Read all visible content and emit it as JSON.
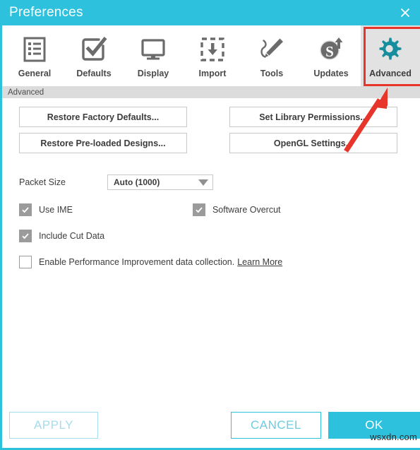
{
  "window": {
    "title": "Preferences",
    "close_icon": "close-x-icon",
    "accent_color": "#2ec1dd",
    "highlight_color": "#e8352b"
  },
  "tabs": [
    {
      "label": "General",
      "icon": "list-document-icon",
      "selected": false
    },
    {
      "label": "Defaults",
      "icon": "checkbox-check-icon",
      "selected": false
    },
    {
      "label": "Display",
      "icon": "monitor-icon",
      "selected": false
    },
    {
      "label": "Import",
      "icon": "import-download-icon",
      "selected": false
    },
    {
      "label": "Tools",
      "icon": "pen-tool-icon",
      "selected": false
    },
    {
      "label": "Updates",
      "icon": "updates-s-arrow-icon",
      "selected": false
    },
    {
      "label": "Advanced",
      "icon": "gear-icon",
      "selected": true
    }
  ],
  "subheader": {
    "label": "Advanced"
  },
  "content": {
    "buttons_left": [
      {
        "label": "Restore Factory Defaults..."
      },
      {
        "label": "Restore Pre-loaded Designs..."
      }
    ],
    "buttons_right": [
      {
        "label": "Set Library Permissions..."
      },
      {
        "label": "OpenGL Settings..."
      }
    ],
    "packet_size": {
      "label": "Packet Size",
      "value": "Auto (1000)",
      "caret_icon": "chevron-down-icon"
    },
    "checkboxes": [
      {
        "label": "Use IME",
        "checked": true
      },
      {
        "label": "Software Overcut",
        "checked": true
      },
      {
        "label": "Include Cut Data",
        "checked": true
      },
      {
        "label": "Enable Performance Improvement data collection.",
        "checked": false,
        "link": "Learn More"
      }
    ]
  },
  "footer": {
    "apply_label": "APPLY",
    "cancel_label": "CANCEL",
    "ok_label": "OK"
  },
  "watermark": {
    "text": "wsxdn.com"
  }
}
